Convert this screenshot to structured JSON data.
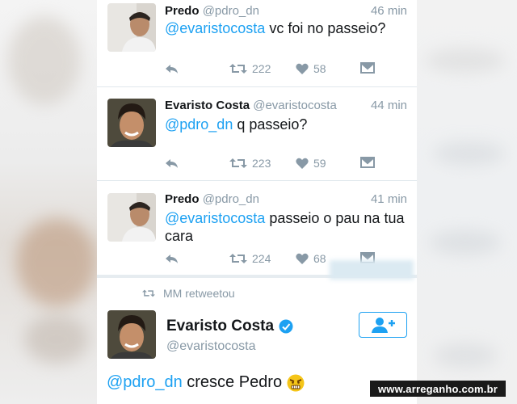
{
  "tweets": [
    {
      "name": "Predo",
      "handle": "@pdro_dn",
      "time": "46 min",
      "mention": "@evaristocosta",
      "text": " vc foi no passeio?",
      "retweets": "222",
      "likes": "58"
    },
    {
      "name": "Evaristo Costa",
      "handle": "@evaristocosta",
      "time": "44 min",
      "mention": "@pdro_dn",
      "text": " q passeio?",
      "retweets": "223",
      "likes": "59"
    },
    {
      "name": "Predo",
      "handle": "@pdro_dn",
      "time": "41 min",
      "mention": "@evaristocosta",
      "text": " passeio o pau na tua cara",
      "retweets": "224",
      "likes": "68"
    }
  ],
  "retweet_banner": "MM retweetou",
  "featured": {
    "name": "Evaristo Costa",
    "handle": "@evaristocosta",
    "mention": "@pdro_dn",
    "text": " cresce Pedro",
    "verified": true
  },
  "watermark": "www.arreganho.com.br",
  "colors": {
    "accent": "#1da1f2",
    "muted": "#8899a6",
    "text": "#14171a"
  },
  "icons": [
    "reply-icon",
    "retweet-icon",
    "like-icon",
    "dm-icon",
    "verified-badge-icon",
    "follow-icon",
    "angry-emoji-icon"
  ]
}
